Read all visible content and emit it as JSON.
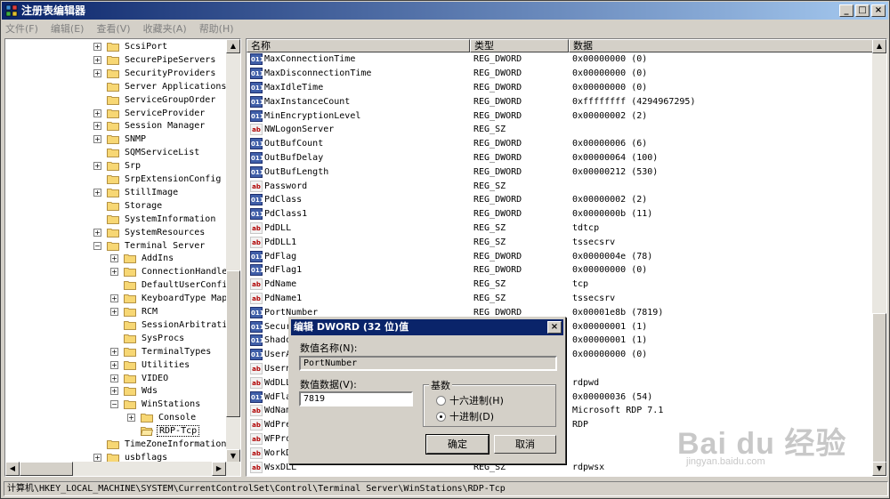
{
  "window": {
    "title": "注册表编辑器",
    "buttons": [
      "_",
      "□",
      "×"
    ]
  },
  "menu": [
    "文件(F)",
    "编辑(E)",
    "查看(V)",
    "收藏夹(A)",
    "帮助(H)"
  ],
  "tree": [
    {
      "label": "ScsiPort",
      "level": 0,
      "exp": "+"
    },
    {
      "label": "SecurePipeServers",
      "level": 0,
      "exp": "+"
    },
    {
      "label": "SecurityProviders",
      "level": 0,
      "exp": "+"
    },
    {
      "label": "Server Applications",
      "level": 0,
      "exp": ""
    },
    {
      "label": "ServiceGroupOrder",
      "level": 0,
      "exp": ""
    },
    {
      "label": "ServiceProvider",
      "level": 0,
      "exp": "+"
    },
    {
      "label": "Session Manager",
      "level": 0,
      "exp": "+"
    },
    {
      "label": "SNMP",
      "level": 0,
      "exp": "+"
    },
    {
      "label": "SQMServiceList",
      "level": 0,
      "exp": ""
    },
    {
      "label": "Srp",
      "level": 0,
      "exp": "+"
    },
    {
      "label": "SrpExtensionConfig",
      "level": 0,
      "exp": ""
    },
    {
      "label": "StillImage",
      "level": 0,
      "exp": "+"
    },
    {
      "label": "Storage",
      "level": 0,
      "exp": ""
    },
    {
      "label": "SystemInformation",
      "level": 0,
      "exp": ""
    },
    {
      "label": "SystemResources",
      "level": 0,
      "exp": "+"
    },
    {
      "label": "Terminal Server",
      "level": 0,
      "exp": "−"
    },
    {
      "label": "AddIns",
      "level": 1,
      "exp": "+"
    },
    {
      "label": "ConnectionHandler",
      "level": 1,
      "exp": "+"
    },
    {
      "label": "DefaultUserConfigu",
      "level": 1,
      "exp": ""
    },
    {
      "label": "KeyboardType Mappi",
      "level": 1,
      "exp": "+"
    },
    {
      "label": "RCM",
      "level": 1,
      "exp": "+"
    },
    {
      "label": "SessionArbitration",
      "level": 1,
      "exp": ""
    },
    {
      "label": "SysProcs",
      "level": 1,
      "exp": ""
    },
    {
      "label": "TerminalTypes",
      "level": 1,
      "exp": "+"
    },
    {
      "label": "Utilities",
      "level": 1,
      "exp": "+"
    },
    {
      "label": "VIDEO",
      "level": 1,
      "exp": "+"
    },
    {
      "label": "Wds",
      "level": 1,
      "exp": "+"
    },
    {
      "label": "WinStations",
      "level": 1,
      "exp": "−"
    },
    {
      "label": "Console",
      "level": 2,
      "exp": "+"
    },
    {
      "label": "RDP-Tcp",
      "level": 2,
      "exp": "",
      "selected": true
    },
    {
      "label": "TimeZoneInformation",
      "level": 0,
      "exp": ""
    },
    {
      "label": "usbflags",
      "level": 0,
      "exp": "+"
    }
  ],
  "columns": {
    "name": "名称",
    "type": "类型",
    "data": "数据"
  },
  "values": [
    {
      "name": "MaxConnectionTime",
      "type": "REG_DWORD",
      "data": "0x00000000 (0)",
      "icon": "dword"
    },
    {
      "name": "MaxDisconnectionTime",
      "type": "REG_DWORD",
      "data": "0x00000000 (0)",
      "icon": "dword"
    },
    {
      "name": "MaxIdleTime",
      "type": "REG_DWORD",
      "data": "0x00000000 (0)",
      "icon": "dword"
    },
    {
      "name": "MaxInstanceCount",
      "type": "REG_DWORD",
      "data": "0xffffffff (4294967295)",
      "icon": "dword"
    },
    {
      "name": "MinEncryptionLevel",
      "type": "REG_DWORD",
      "data": "0x00000002 (2)",
      "icon": "dword"
    },
    {
      "name": "NWLogonServer",
      "type": "REG_SZ",
      "data": "",
      "icon": "sz"
    },
    {
      "name": "OutBufCount",
      "type": "REG_DWORD",
      "data": "0x00000006 (6)",
      "icon": "dword"
    },
    {
      "name": "OutBufDelay",
      "type": "REG_DWORD",
      "data": "0x00000064 (100)",
      "icon": "dword"
    },
    {
      "name": "OutBufLength",
      "type": "REG_DWORD",
      "data": "0x00000212 (530)",
      "icon": "dword"
    },
    {
      "name": "Password",
      "type": "REG_SZ",
      "data": "",
      "icon": "sz"
    },
    {
      "name": "PdClass",
      "type": "REG_DWORD",
      "data": "0x00000002 (2)",
      "icon": "dword"
    },
    {
      "name": "PdClass1",
      "type": "REG_DWORD",
      "data": "0x0000000b (11)",
      "icon": "dword"
    },
    {
      "name": "PdDLL",
      "type": "REG_SZ",
      "data": "tdtcp",
      "icon": "sz"
    },
    {
      "name": "PdDLL1",
      "type": "REG_SZ",
      "data": "tssecsrv",
      "icon": "sz"
    },
    {
      "name": "PdFlag",
      "type": "REG_DWORD",
      "data": "0x0000004e (78)",
      "icon": "dword"
    },
    {
      "name": "PdFlag1",
      "type": "REG_DWORD",
      "data": "0x00000000 (0)",
      "icon": "dword"
    },
    {
      "name": "PdName",
      "type": "REG_SZ",
      "data": "tcp",
      "icon": "sz"
    },
    {
      "name": "PdName1",
      "type": "REG_SZ",
      "data": "tssecsrv",
      "icon": "sz"
    },
    {
      "name": "PortNumber",
      "type": "REG_DWORD",
      "data": "0x00001e8b (7819)",
      "icon": "dword"
    },
    {
      "name": "Secur",
      "type": "",
      "data": "0x00000001 (1)",
      "icon": "dword"
    },
    {
      "name": "Shado",
      "type": "",
      "data": "0x00000001 (1)",
      "icon": "dword"
    },
    {
      "name": "UserA",
      "type": "",
      "data": "0x00000000 (0)",
      "icon": "dword"
    },
    {
      "name": "Usern",
      "type": "",
      "data": "",
      "icon": "sz"
    },
    {
      "name": "WdDLL",
      "type": "",
      "data": "rdpwd",
      "icon": "sz"
    },
    {
      "name": "WdFla",
      "type": "",
      "data": "0x00000036 (54)",
      "icon": "dword"
    },
    {
      "name": "WdNam",
      "type": "",
      "data": "Microsoft RDP 7.1",
      "icon": "sz"
    },
    {
      "name": "WdPre",
      "type": "",
      "data": "RDP",
      "icon": "sz"
    },
    {
      "name": "WFPro",
      "type": "",
      "data": "",
      "icon": "sz"
    },
    {
      "name": "WorkD",
      "type": "",
      "data": "",
      "icon": "sz"
    },
    {
      "name": "WsxDLL",
      "type": "REG_SZ",
      "data": "rdpwsx",
      "icon": "sz"
    }
  ],
  "status": "计算机\\HKEY_LOCAL_MACHINE\\SYSTEM\\CurrentControlSet\\Control\\Terminal Server\\WinStations\\RDP-Tcp",
  "dialog": {
    "title": "编辑 DWORD (32 位)值",
    "close": "×",
    "name_label": "数值名称(N):",
    "name_value": "PortNumber",
    "data_label": "数值数据(V):",
    "data_value": "7819",
    "base_label": "基数",
    "hex_label": "十六进制(H)",
    "dec_label": "十进制(D)",
    "base_selected": "decimal",
    "ok": "确定",
    "cancel": "取消"
  },
  "watermark": {
    "logo": "Bai du 经验",
    "url": "jingyan.baidu.com"
  }
}
